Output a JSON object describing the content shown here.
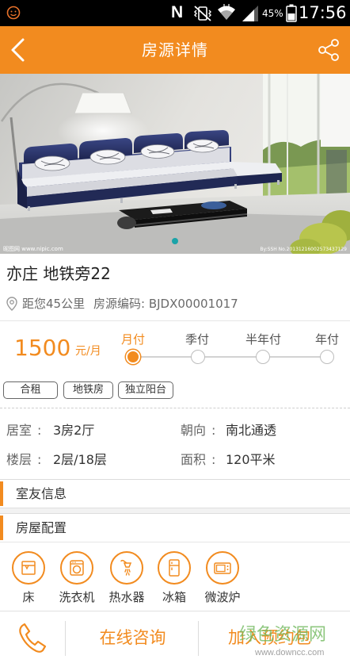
{
  "status_bar": {
    "network_letter": "N",
    "battery": "45%",
    "time": "17:56",
    "icons": [
      "app-notification-icon",
      "vibrate-mute-icon",
      "wifi-icon",
      "signal-icon",
      "battery-icon"
    ]
  },
  "header": {
    "title": "房源详情",
    "back_icon": "back-arrow-icon",
    "share_icon": "share-icon"
  },
  "hero": {
    "photo": "living-room-photo",
    "watermark_left": "昵图网 www.nipic.com",
    "watermark_right": "By:SSH No.20131216002573437129"
  },
  "listing": {
    "title": "亦庄 地铁旁22",
    "distance": "距您45公里",
    "code": "房源编码: BJDX00001017",
    "price": "1500",
    "price_unit": "元/月",
    "payment_options": [
      {
        "label": "月付",
        "selected": true
      },
      {
        "label": "季付",
        "selected": false
      },
      {
        "label": "半年付",
        "selected": false
      },
      {
        "label": "年付",
        "selected": false
      }
    ],
    "tags": [
      "合租",
      "地铁房",
      "独立阳台"
    ],
    "detail_separator": ":",
    "details": [
      {
        "label": "居室",
        "value": "3房2厅"
      },
      {
        "label": "朝向",
        "value": "南北通透"
      },
      {
        "label": "楼层",
        "value": "2层/18层"
      },
      {
        "label": "面积",
        "value": "120平米"
      }
    ]
  },
  "sections": {
    "roommates": "室友信息",
    "config": "房屋配置"
  },
  "amenities": [
    {
      "label": "床",
      "icon": "bed-icon"
    },
    {
      "label": "洗衣机",
      "icon": "washing-machine-icon"
    },
    {
      "label": "热水器",
      "icon": "water-heater-icon"
    },
    {
      "label": "冰箱",
      "icon": "fridge-icon"
    },
    {
      "label": "微波炉",
      "icon": "microwave-icon"
    }
  ],
  "bottom_bar": {
    "phone_icon": "phone-icon",
    "consult_label": "在线咨询",
    "reserve_label": "加入预约包"
  },
  "watermark": {
    "site_name": "绿色资源网",
    "site_url": "www.downcc.com"
  },
  "colors": {
    "accent": "#F28B1F",
    "carousel_dot": "#1BA3A8",
    "watermark_green": "#6fb85c"
  }
}
